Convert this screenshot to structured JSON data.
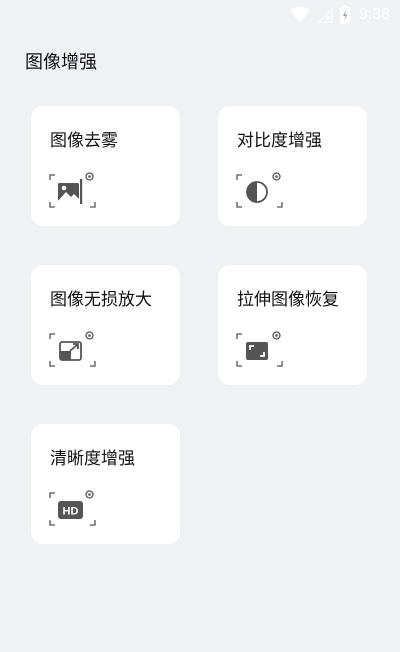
{
  "status_bar": {
    "time": "9:38",
    "icons": [
      "wifi-icon",
      "signal-icon",
      "battery-icon"
    ]
  },
  "page": {
    "title": "图像增强"
  },
  "cards": [
    {
      "label": "图像去雾",
      "icon": "image-dehaze-icon"
    },
    {
      "label": "对比度增强",
      "icon": "contrast-icon"
    },
    {
      "label": "图像无损放大",
      "icon": "upscale-icon"
    },
    {
      "label": "拉伸图像恢复",
      "icon": "stretch-restore-icon"
    },
    {
      "label": "清晰度增强",
      "icon": "hd-icon"
    }
  ],
  "hd_badge_text": "HD",
  "colors": {
    "background": "#f0f1f3",
    "card": "#ffffff",
    "icon": "#555555"
  }
}
